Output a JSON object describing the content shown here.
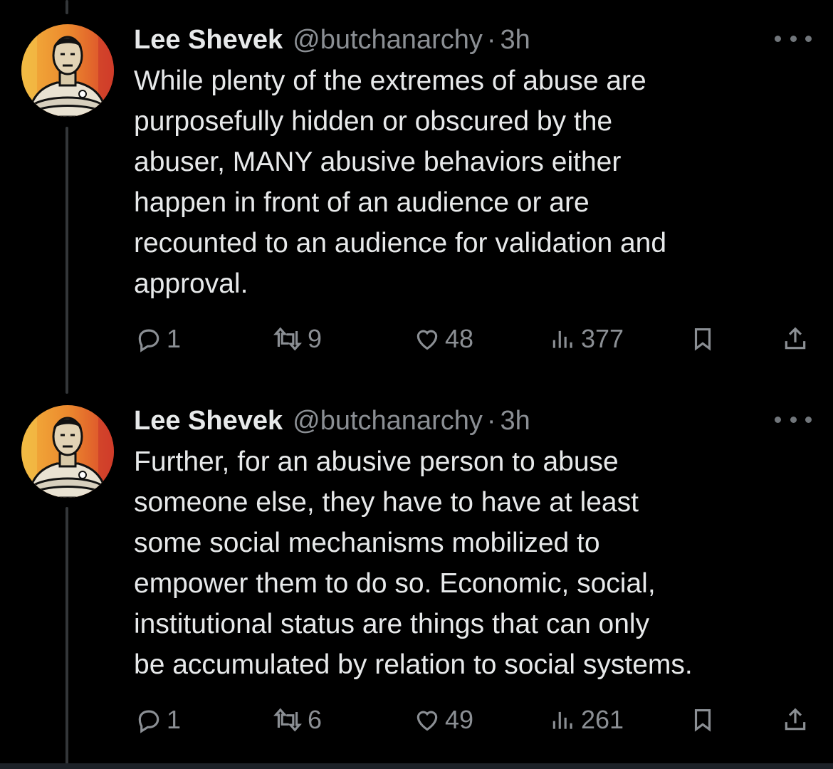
{
  "tweets": [
    {
      "author": {
        "name": "Lee Shevek",
        "handle": "@butchanarchy",
        "separator": "·",
        "time": "3h"
      },
      "lines": [
        "While plenty of the extremes of abuse are",
        "purposefully hidden or obscured by the",
        "abuser, MANY abusive behaviors either",
        "happen in front of an audience or are",
        "recounted to an audience for validation and",
        "approval."
      ],
      "stats": {
        "replies": "1",
        "reposts": "9",
        "likes": "48",
        "views": "377"
      }
    },
    {
      "author": {
        "name": "Lee Shevek",
        "handle": "@butchanarchy",
        "separator": "·",
        "time": "3h"
      },
      "lines": [
        "Further, for an abusive person to abuse",
        "someone else, they have to have at least",
        "some social mechanisms mobilized to",
        "empower them to do so. Economic, social,",
        "institutional status are things that can only",
        "be accumulated by relation to social systems."
      ],
      "stats": {
        "replies": "1",
        "reposts": "6",
        "likes": "49",
        "views": "261"
      }
    }
  ],
  "icons": {
    "reply": "reply-icon",
    "repost": "repost-icon",
    "like": "heart-icon",
    "views": "views-icon",
    "bookmark": "bookmark-icon",
    "share": "share-icon",
    "more": "more-icon"
  },
  "colors": {
    "background": "#000000",
    "text": "#e7e9ea",
    "muted": "#8b8f94",
    "avatar_gradient": [
      "#f2a93b",
      "#e8752a",
      "#d94a2a"
    ]
  }
}
